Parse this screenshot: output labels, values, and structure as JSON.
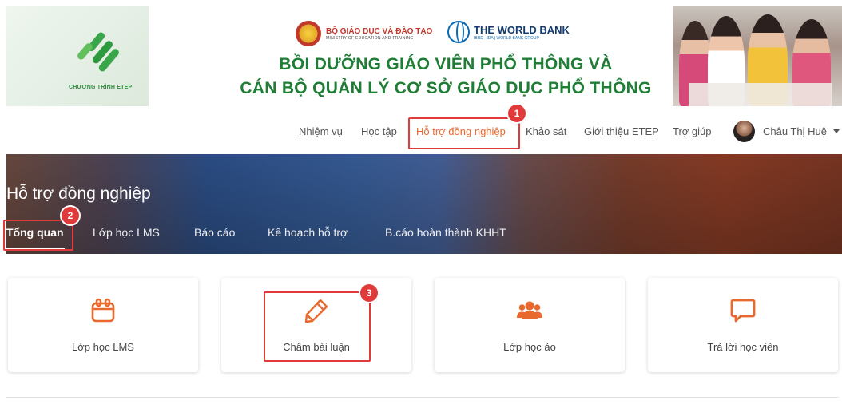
{
  "header": {
    "program_logo_label": "CHƯƠNG TRÌNH ETEP",
    "ministry_name": "BỘ GIÁO DỤC VÀ ĐÀO TẠO",
    "ministry_name_en": "MINISTRY OF EDUCATION AND TRAINING",
    "world_bank_name": "THE WORLD BANK",
    "world_bank_sub": "IBRD · IDA | WORLD BANK GROUP",
    "title_line1": "BỒI DƯỠNG GIÁO VIÊN PHỔ THÔNG VÀ",
    "title_line2": "CÁN BỘ QUẢN LÝ CƠ SỞ GIÁO DỤC PHỔ THÔNG",
    "brand_green": "#1f7d36"
  },
  "nav": {
    "items": [
      {
        "label": "Nhiệm vụ"
      },
      {
        "label": "Học tập"
      },
      {
        "label": "Hỗ trợ đồng nghiệp",
        "active": true
      },
      {
        "label": "Khảo sát"
      },
      {
        "label": "Giới thiệu ETEP"
      },
      {
        "label": "Trợ giúp"
      }
    ],
    "user_name": "Châu Thị Huệ",
    "active_color": "#e8692d"
  },
  "hero": {
    "title": "Hỗ trợ đồng nghiệp",
    "tabs": [
      {
        "label": "Tổng quan",
        "active": true
      },
      {
        "label": "Lớp học LMS"
      },
      {
        "label": "Báo cáo"
      },
      {
        "label": "Kế hoạch hỗ trợ"
      },
      {
        "label": "B.cáo hoàn thành KHHT"
      }
    ]
  },
  "cards": [
    {
      "label": "Lớp học LMS",
      "icon": "calendar-icon"
    },
    {
      "label": "Chấm bài luận",
      "icon": "pencil-icon"
    },
    {
      "label": "Lớp học ảo",
      "icon": "users-icon"
    },
    {
      "label": "Trả lời học viên",
      "icon": "chat-icon"
    }
  ],
  "icon_color": "#e8692d",
  "annotations": {
    "steps": [
      "1",
      "2",
      "3"
    ],
    "color": "#e03a3a"
  }
}
